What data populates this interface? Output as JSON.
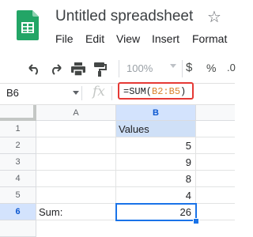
{
  "app": {
    "title": "Untitled spreadsheet",
    "menu": [
      "File",
      "Edit",
      "View",
      "Insert",
      "Format"
    ]
  },
  "toolbar": {
    "zoom": "100%",
    "currency": "$",
    "percent": "%",
    "decimal": ".0"
  },
  "formula_bar": {
    "name_box": "B6",
    "fx": "fx",
    "formula_prefix": "=SUM(",
    "formula_ref": "B2:B5",
    "formula_suffix": ")"
  },
  "grid": {
    "columns": [
      "A",
      "B"
    ],
    "rows": [
      "1",
      "2",
      "3",
      "4",
      "5",
      "6"
    ],
    "cells": {
      "B1": "Values",
      "B2": "5",
      "B3": "9",
      "B4": "8",
      "B5": "4",
      "A6": "Sum:",
      "B6": "26"
    },
    "selected_cell": "B6"
  },
  "colors": {
    "highlight_box": "#e53935",
    "header_fill": "#cfe0f7",
    "selection": "#1a73e8",
    "logo": "#23a566"
  }
}
